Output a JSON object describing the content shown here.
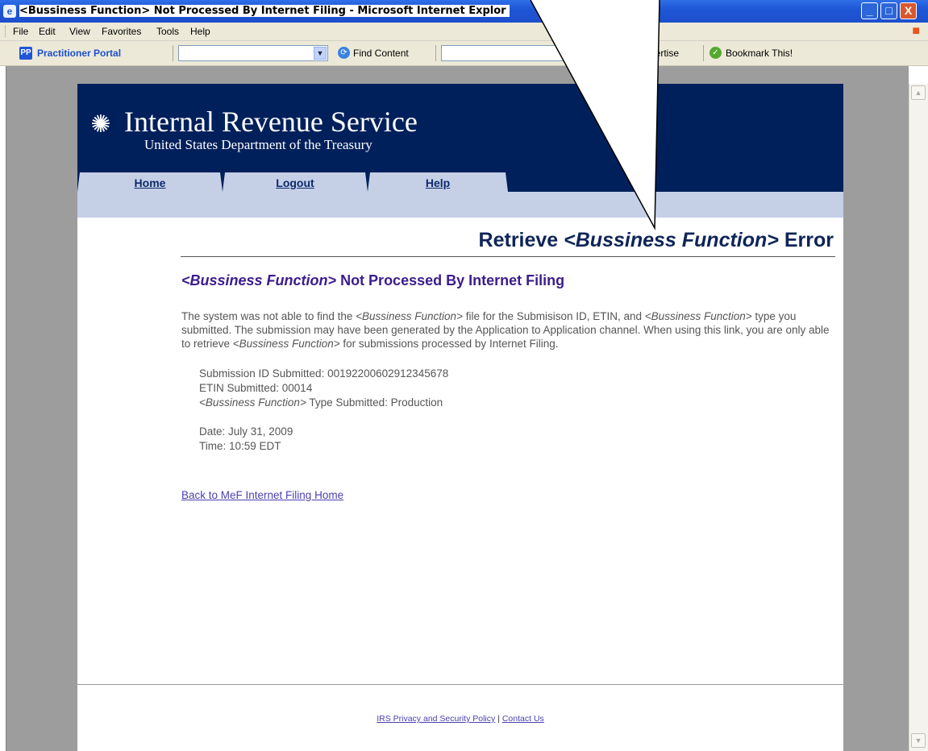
{
  "window": {
    "title": "<Bussiness Function> Not Processed By Internet Filing - Microsoft Internet Explor",
    "buttons": {
      "minimize": "_",
      "maximize": "□",
      "close": "X"
    }
  },
  "menu": [
    "File",
    "Edit",
    "View",
    "Favorites",
    "Tools",
    "Help"
  ],
  "toolbar": {
    "portal_label": "Practitioner Portal",
    "find_label": "Find Content",
    "expertise_label": "pertise",
    "bookmark_label": "Bookmark This!"
  },
  "header": {
    "agency": "Internal Revenue Service",
    "department": "United States Department of the Treasury",
    "tabs": [
      "Home",
      "Logout",
      "Help"
    ]
  },
  "main": {
    "heading_prefix": "Retrieve ",
    "heading_var": "<Bussiness Function>",
    "heading_suffix": " Error",
    "sub_var": "<Bussiness Function>",
    "sub_suffix": " Not Processed By Internet Filing",
    "p1": "The system was not able to find the ",
    "p_var1": "<Bussiness Function>",
    "p2": " file for the Submisison ID, ETIN, and ",
    "p_var2": "<Bussiness Function>",
    "p3": " type you submitted. The submission may have been generated by the Application to Application channel. When using this link, you are only able to retrieve ",
    "p_var3": "<Bussiness Function>",
    "p4": " for submissions processed by Internet Filing.",
    "details": {
      "submission_id": "Submission ID Submitted:  00192200602912345678",
      "etin": "ETIN Submitted:  00014",
      "type_var": "<Bussiness Function>",
      "type_rest": " Type Submitted:  Production",
      "date": "Date:  July 31, 2009",
      "time": "Time:  10:59 EDT"
    },
    "back_link": "Back to MeF Internet Filing Home"
  },
  "footer": {
    "privacy": "IRS Privacy and Security Policy",
    "separator": " | ",
    "contact": "Contact Us"
  },
  "colors": {
    "header_navy": "#00205b",
    "tab_light": "#c5d0e6",
    "subheading_purple": "#3b1c8c",
    "link": "#4b3fb0"
  }
}
